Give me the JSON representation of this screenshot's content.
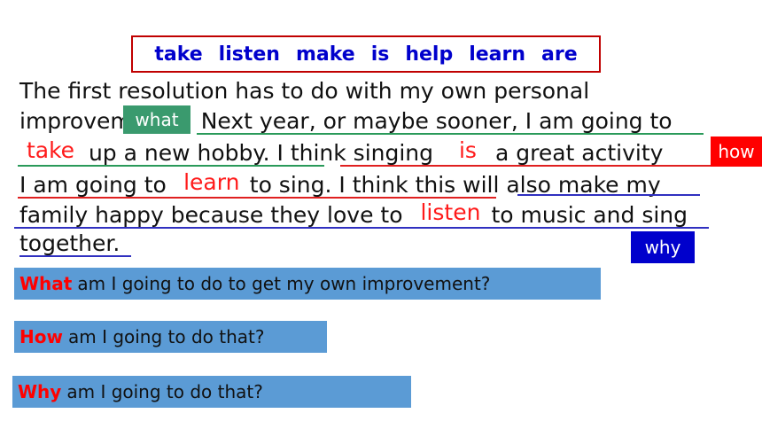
{
  "word_bank": [
    "take",
    "listen",
    "make",
    "is",
    "help",
    "learn",
    "are"
  ],
  "passage": {
    "line1": "The first resolution has to do with my own personal",
    "line2_a": "improvem",
    "line2_b": "Next year, or maybe sooner, I am going to",
    "line3_b": " up a new hobby. I think singing ",
    "line3_c": "a great activity ",
    "line4_a": "I am going to ",
    "line4_b": "to sing. I think this will also make my",
    "line5_a": "family happy because they love to ",
    "line5_b": "to music and sing",
    "line6": "together."
  },
  "answers": {
    "blank1": "take",
    "blank2": "is",
    "blank3": "learn",
    "blank4": "listen"
  },
  "tags": {
    "what": "what",
    "how": "how",
    "why": "why"
  },
  "questions": [
    {
      "keyword": "What",
      "text": "am I  going to do to get my own improvement?"
    },
    {
      "keyword": "How",
      "text": "am I going to do that?"
    },
    {
      "keyword": "Why",
      "text": "am I going to do that?"
    }
  ],
  "colors": {
    "word_bank_text": "#0000cc",
    "word_bank_border": "#c00000",
    "answer": "#ff1a1a",
    "what_tag": "#3a9a6e",
    "how_tag": "#ff0000",
    "why_tag": "#0000cc",
    "question_bg": "#5b9bd5"
  }
}
